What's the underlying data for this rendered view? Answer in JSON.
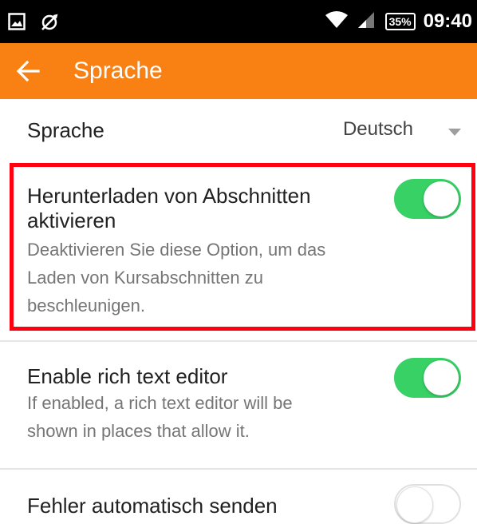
{
  "status_bar": {
    "battery": "35%",
    "time": "09:40"
  },
  "toolbar": {
    "title": "Sprache",
    "back_icon": "arrow-back-icon"
  },
  "language": {
    "label": "Sprache",
    "value": "Deutsch"
  },
  "settings": [
    {
      "title_line1": "Herunterladen von Abschnitten",
      "title_line2": "aktivieren",
      "desc_line1": "Deaktivieren Sie diese Option, um das",
      "desc_line2": "Laden von Kursabschnitten zu",
      "desc_line3": "beschleunigen.",
      "enabled": true
    },
    {
      "title": "Enable rich text editor",
      "desc_line1": "If enabled, a rich text editor will be",
      "desc_line2": "shown in places that allow it.",
      "enabled": true
    },
    {
      "title": "Fehler automatisch senden",
      "enabled": false
    }
  ],
  "colors": {
    "accent": "#f98012",
    "toggle_on": "#38d165",
    "highlight": "#ff0010"
  }
}
